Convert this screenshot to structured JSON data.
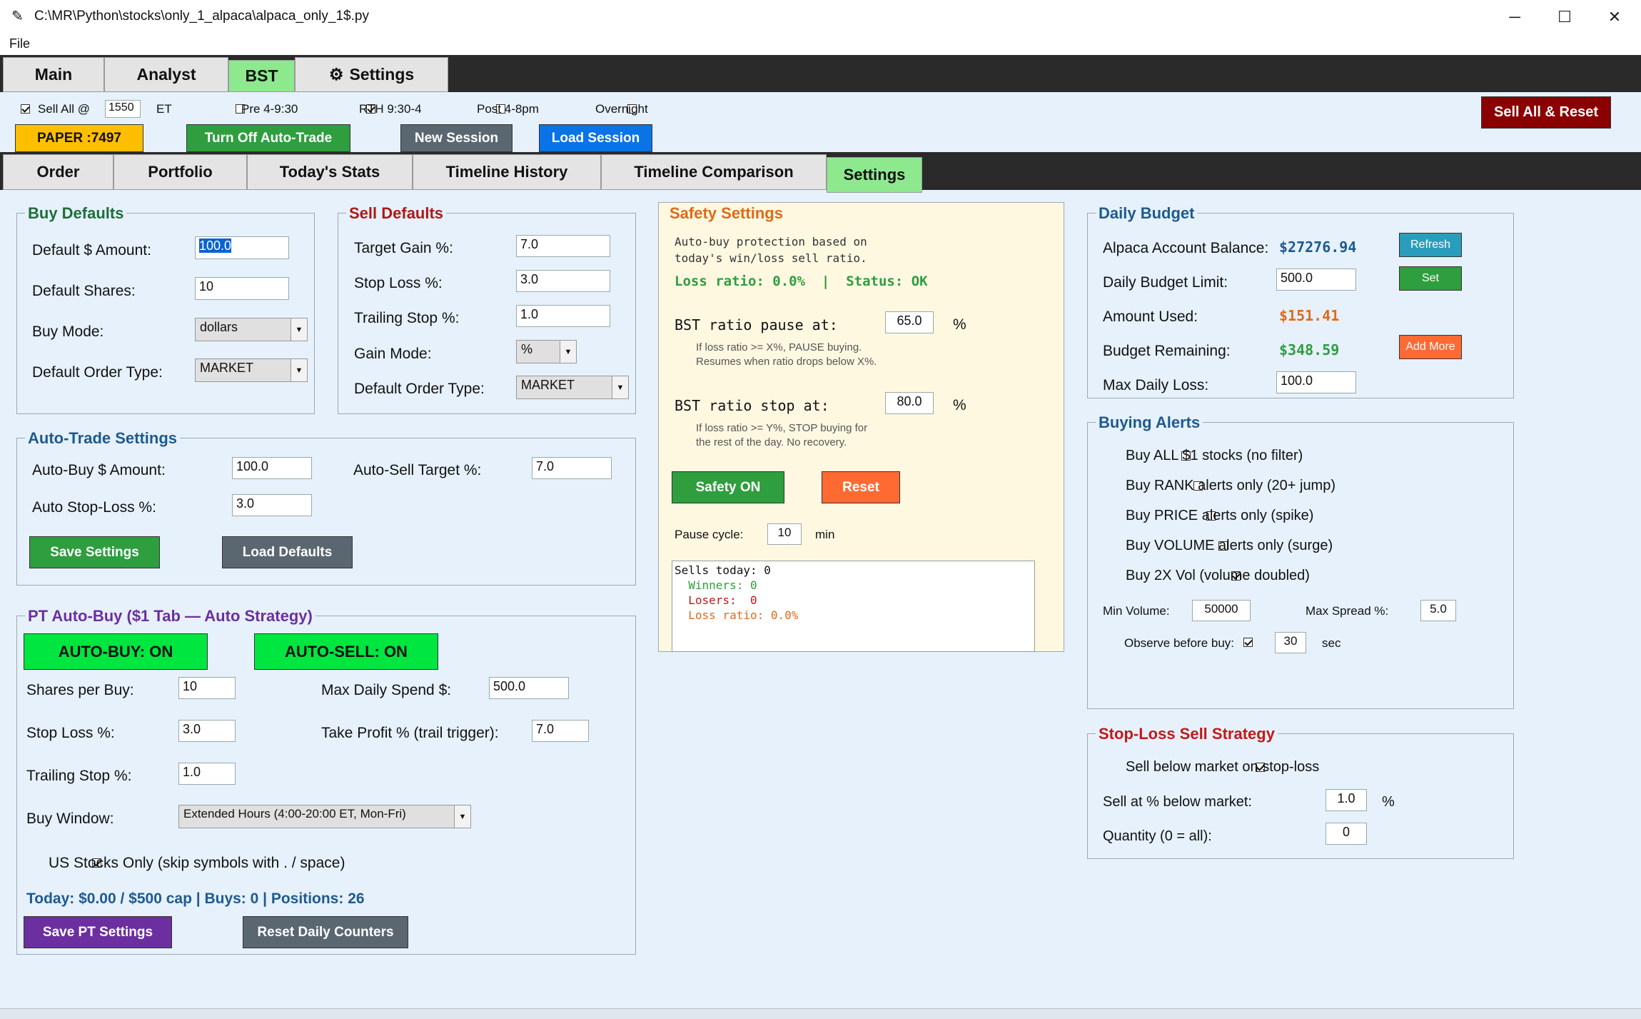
{
  "window": {
    "title": "C:\\MR\\Python\\stocks\\only_1_alpaca\\alpaca_only_1$.py",
    "min": "─",
    "max": "☐",
    "close": "✕"
  },
  "menu": {
    "file": "File"
  },
  "main_tabs": {
    "main": "Main",
    "analyst": "Analyst",
    "bst": "BST",
    "settings": "Settings"
  },
  "top": {
    "sell_all_label": "Sell All @",
    "sell_all_time": "1550",
    "et": "ET",
    "pre": "Pre 4-9:30",
    "rth": "RTH 9:30-4",
    "post": "Post 4-8pm",
    "overnight": "Overnight",
    "sell_all_reset": "Sell All & Reset",
    "paper": "PAPER :7497",
    "turn_off": "Turn Off Auto-Trade",
    "new_session": "New Session",
    "load_session": "Load Session"
  },
  "sub_tabs": {
    "order": "Order",
    "portfolio": "Portfolio",
    "stats": "Today's Stats",
    "timeline_history": "Timeline History",
    "timeline_comparison": "Timeline Comparison",
    "settings": "Settings"
  },
  "buy_defaults": {
    "title": "Buy Defaults",
    "amount_label": "Default $ Amount:",
    "amount": "100.0",
    "shares_label": "Default Shares:",
    "shares": "10",
    "mode_label": "Buy Mode:",
    "mode": "dollars",
    "order_label": "Default Order Type:",
    "order": "MARKET"
  },
  "sell_defaults": {
    "title": "Sell Defaults",
    "target_label": "Target Gain %:",
    "target": "7.0",
    "stop_label": "Stop Loss %:",
    "stop": "3.0",
    "trail_label": "Trailing Stop %:",
    "trail": "1.0",
    "gain_mode_label": "Gain Mode:",
    "gain_mode": "%",
    "order_label": "Default Order Type:",
    "order": "MARKET"
  },
  "auto_trade": {
    "title": "Auto-Trade Settings",
    "buy_label": "Auto-Buy $ Amount:",
    "buy": "100.0",
    "sell_label": "Auto-Sell Target %:",
    "sell": "7.0",
    "stop_label": "Auto Stop-Loss %:",
    "stop": "3.0",
    "save": "Save Settings",
    "load": "Load Defaults"
  },
  "pt": {
    "title": "PT Auto-Buy  ($1 Tab — Auto Strategy)",
    "auto_buy": "AUTO-BUY: ON",
    "auto_sell": "AUTO-SELL: ON",
    "shares_label": "Shares per Buy:",
    "shares": "10",
    "max_spend_label": "Max Daily Spend $:",
    "max_spend": "500.0",
    "stop_label": "Stop Loss %:",
    "stop": "3.0",
    "take_label": "Take Profit % (trail trigger):",
    "take": "7.0",
    "trail_label": "Trailing Stop %:",
    "trail": "1.0",
    "window_label": "Buy Window:",
    "window": "Extended Hours  (4:00-20:00 ET, Mon-Fri)",
    "us_only": "US Stocks Only (skip symbols with . / space)",
    "summary": "Today: $0.00 / $500 cap  |  Buys: 0  |  Positions: 26",
    "save": "Save PT Settings",
    "reset": "Reset Daily Counters"
  },
  "safety": {
    "title": "Safety Settings",
    "desc1": "Auto-buy protection based on",
    "desc2": "today's win/loss sell ratio.",
    "status": "Loss ratio: 0.0%  |  Status: OK",
    "pause_label": "BST ratio pause at:",
    "pause": "65.0",
    "pct": "%",
    "pause_note1": "If loss ratio >= X%, PAUSE buying.",
    "pause_note2": "Resumes when ratio drops below X%.",
    "stop_label": "BST ratio stop at:",
    "stop": "80.0",
    "stop_note1": "If loss ratio >= Y%, STOP buying for",
    "stop_note2": "the rest of the day. No recovery.",
    "safety_on": "Safety ON",
    "reset": "Reset",
    "cycle_label": "Pause cycle:",
    "cycle": "10",
    "min": "min",
    "log1": "Sells today: 0",
    "log2": "  Winners: 0",
    "log3": "  Losers:  0",
    "log4": "  Loss ratio: 0.0%"
  },
  "budget": {
    "title": "Daily Budget",
    "balance_label": "Alpaca Account Balance:",
    "balance": "$27276.94",
    "refresh": "Refresh",
    "limit_label": "Daily Budget Limit:",
    "limit": "500.0",
    "set": "Set",
    "used_label": "Amount Used:",
    "used": "$151.41",
    "remaining_label": "Budget Remaining:",
    "remaining": "$348.59",
    "add_more": "Add More",
    "max_loss_label": "Max Daily Loss:",
    "max_loss": "100.0"
  },
  "alerts": {
    "title": "Buying Alerts",
    "a1": "Buy ALL $1 stocks (no filter)",
    "a2": "Buy RANK alerts only (20+ jump)",
    "a3": "Buy PRICE alerts only (spike)",
    "a4": "Buy VOLUME alerts only (surge)",
    "a5": "Buy 2X Vol (volume doubled)",
    "min_vol_label": "Min Volume:",
    "min_vol": "50000",
    "max_spread_label": "Max Spread %:",
    "max_spread": "5.0",
    "observe_label": "Observe before buy:",
    "observe": "30",
    "sec": "sec"
  },
  "stoploss": {
    "title": "Stop-Loss Sell Strategy",
    "below": "Sell below market on stop-loss",
    "pct_label": "Sell at % below market:",
    "pct": "1.0",
    "pct_unit": "%",
    "qty_label": "Quantity (0 = all):",
    "qty": "0"
  },
  "colors": {
    "green": "#2e9e3e",
    "bright_green": "#00e640",
    "gray": "#5b6770",
    "blue": "#0a73e6",
    "purple": "#6b2fa0",
    "orange": "#ff6a33",
    "dark_red": "#8b0000",
    "paper": "#ffbf00"
  }
}
